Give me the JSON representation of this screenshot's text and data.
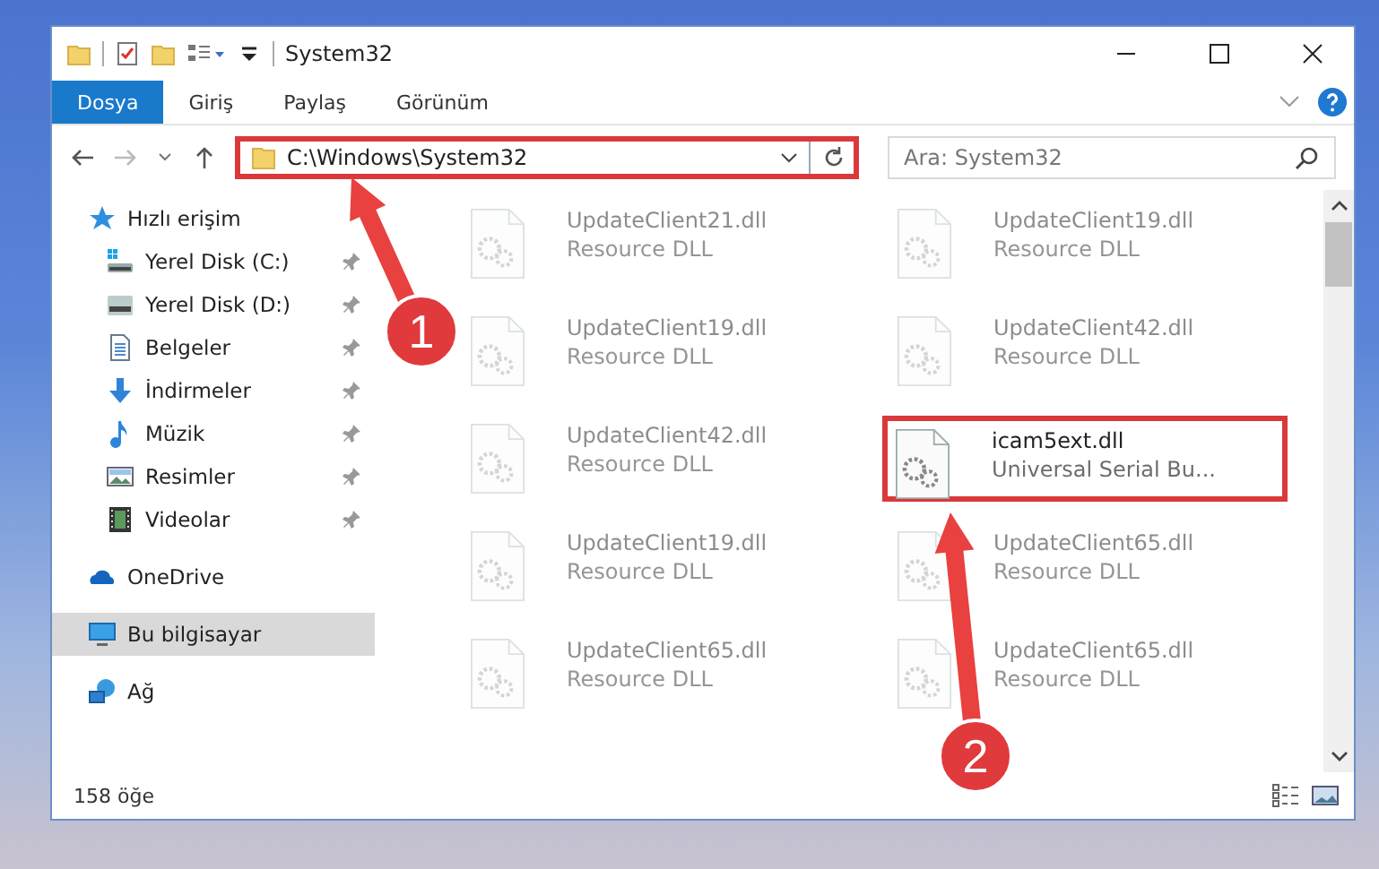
{
  "window": {
    "title": "System32"
  },
  "ribbon": {
    "tabs": [
      {
        "label": "Dosya",
        "selected": true
      },
      {
        "label": "Giriş",
        "selected": false
      },
      {
        "label": "Paylaş",
        "selected": false
      },
      {
        "label": "Görünüm",
        "selected": false
      }
    ]
  },
  "address": {
    "path": "C:\\Windows\\System32",
    "highlighted": true
  },
  "search": {
    "placeholder": "Ara: System32"
  },
  "sidebar": {
    "items": [
      {
        "label": "Hızlı erişim",
        "kind": "star",
        "selected": false,
        "children": [
          {
            "label": "Yerel Disk (C:)",
            "kind": "drive-c",
            "pinned": true,
            "selected": false
          },
          {
            "label": "Yerel Disk (D:)",
            "kind": "drive",
            "pinned": true,
            "selected": false
          },
          {
            "label": "Belgeler",
            "kind": "document",
            "pinned": true,
            "selected": false
          },
          {
            "label": "İndirmeler",
            "kind": "download",
            "pinned": true,
            "selected": false
          },
          {
            "label": "Müzik",
            "kind": "music",
            "pinned": true,
            "selected": false
          },
          {
            "label": "Resimler",
            "kind": "pictures",
            "pinned": true,
            "selected": false
          },
          {
            "label": "Videolar",
            "kind": "video",
            "pinned": true,
            "selected": false
          }
        ]
      },
      {
        "label": "OneDrive",
        "kind": "cloud",
        "selected": false
      },
      {
        "label": "Bu bilgisayar",
        "kind": "computer",
        "selected": true
      },
      {
        "label": "Ağ",
        "kind": "network",
        "selected": false
      }
    ]
  },
  "files": [
    {
      "name": "UpdateClient21.dll",
      "type": "Resource DLL",
      "highlighted": false
    },
    {
      "name": "UpdateClient19.dll",
      "type": "Resource DLL",
      "highlighted": false
    },
    {
      "name": "UpdateClient19.dll",
      "type": "Resource DLL",
      "highlighted": false
    },
    {
      "name": "UpdateClient42.dll",
      "type": "Resource DLL",
      "highlighted": false
    },
    {
      "name": "UpdateClient42.dll",
      "type": "Resource DLL",
      "highlighted": false
    },
    {
      "name": "icam5ext.dll",
      "type": "Universal Serial Bu...",
      "highlighted": true
    },
    {
      "name": "UpdateClient19.dll",
      "type": "Resource DLL",
      "highlighted": false
    },
    {
      "name": "UpdateClient65.dll",
      "type": "Resource DLL",
      "highlighted": false
    },
    {
      "name": "UpdateClient65.dll",
      "type": "Resource DLL",
      "highlighted": false
    },
    {
      "name": "UpdateClient65.dll",
      "type": "Resource DLL",
      "highlighted": false
    }
  ],
  "annotations": [
    {
      "label": "1"
    },
    {
      "label": "2"
    }
  ],
  "status_bar": {
    "count": "158 öğe"
  }
}
